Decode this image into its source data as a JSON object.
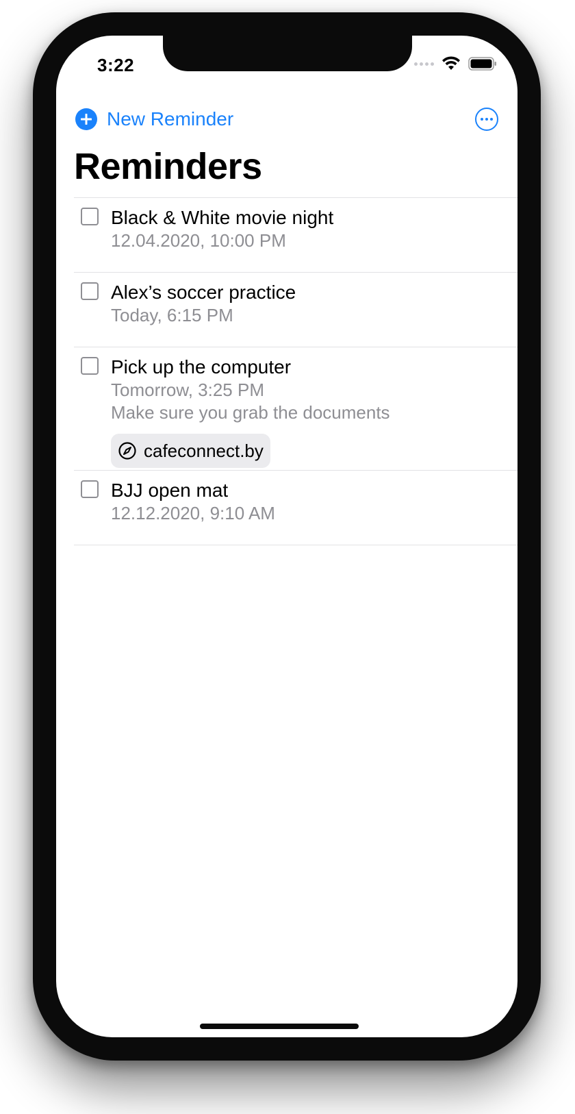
{
  "status_bar": {
    "time": "3:22",
    "icons": [
      "signal-dots-icon",
      "wifi-icon",
      "battery-icon"
    ]
  },
  "toolbar": {
    "new_reminder_label": "New Reminder",
    "plus_icon": "plus-circle-icon",
    "more_icon": "ellipsis-circle-icon"
  },
  "title": "Reminders",
  "colors": {
    "accent": "#1a82fb",
    "secondary_text": "#8e8e93",
    "separator": "#e2e2e4",
    "chip_background": "#ebebee"
  },
  "reminders": [
    {
      "title": "Black & White movie night",
      "date": "12.04.2020, 10:00 PM",
      "completed": false
    },
    {
      "title": "Alex’s soccer practice",
      "date": "Today, 6:15 PM",
      "completed": false
    },
    {
      "title": "Pick up the computer",
      "date": "Tomorrow, 3:25 PM",
      "note": "Make sure you grab the documents",
      "link": {
        "icon": "compass-icon",
        "text": "cafeconnect.by"
      },
      "completed": false
    },
    {
      "title": "BJJ open mat",
      "date": "12.12.2020, 9:10 AM",
      "completed": false
    }
  ]
}
